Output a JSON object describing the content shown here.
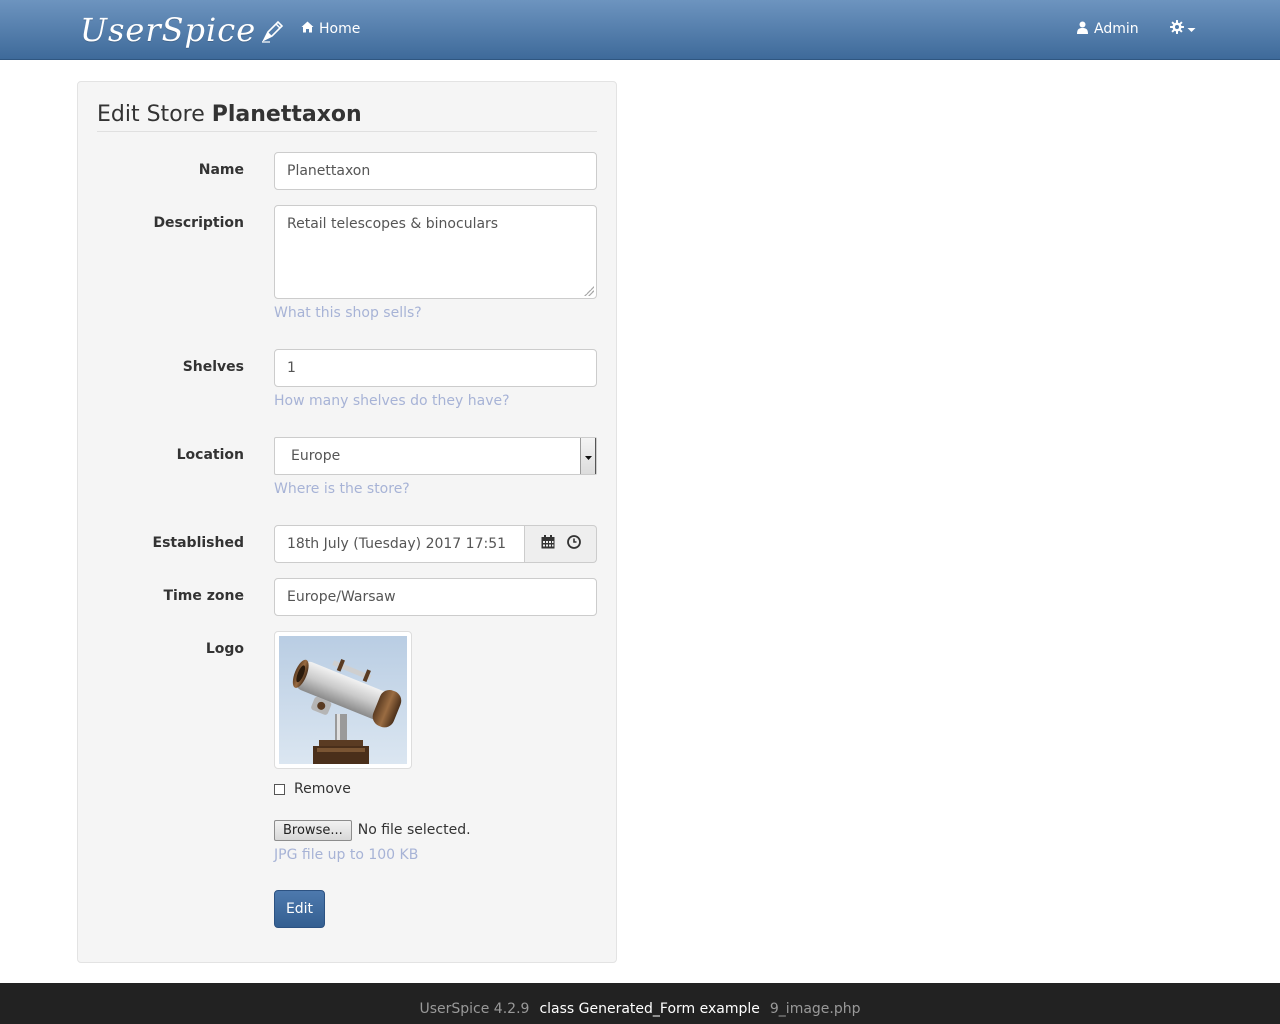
{
  "navbar": {
    "brand": "UserSpice",
    "home_label": "Home",
    "user_label": "Admin",
    "icons": {
      "home": "home-icon",
      "user": "user-icon",
      "settings": "gear-icon",
      "caret": "caret-down-icon",
      "brand": "pencil-logo-icon"
    }
  },
  "form": {
    "title_prefix": "Edit Store",
    "title_name": "Planettaxon",
    "fields": {
      "name": {
        "label": "Name",
        "value": "Planettaxon"
      },
      "description": {
        "label": "Description",
        "value": "Retail telescopes & binoculars",
        "help": "What this shop sells?"
      },
      "shelves": {
        "label": "Shelves",
        "value": "1",
        "help": "How many shelves do they have?"
      },
      "location": {
        "label": "Location",
        "value": "Europe",
        "help": "Where is the store?"
      },
      "established": {
        "label": "Established",
        "value": "18th July (Tuesday) 2017 17:51",
        "icons": [
          "calendar-icon",
          "clock-icon"
        ]
      },
      "timezone": {
        "label": "Time zone",
        "value": "Europe/Warsaw"
      },
      "logo": {
        "label": "Logo",
        "remove_label": "Remove",
        "remove_checked": false,
        "browse_label": "Browse...",
        "file_status": "No file selected.",
        "help": "JPG file up to 100 KB"
      }
    },
    "submit_label": "Edit"
  },
  "footer": {
    "version": "UserSpice 4.2.9",
    "title": "class Generated_Form example",
    "file": "9_image.php"
  },
  "colors": {
    "navbar_top": "#6d94bf",
    "navbar_bottom": "#3e6a9a",
    "help_text": "#a7b3d6",
    "primary_button": "#3d6899",
    "footer_bg": "#222222"
  }
}
